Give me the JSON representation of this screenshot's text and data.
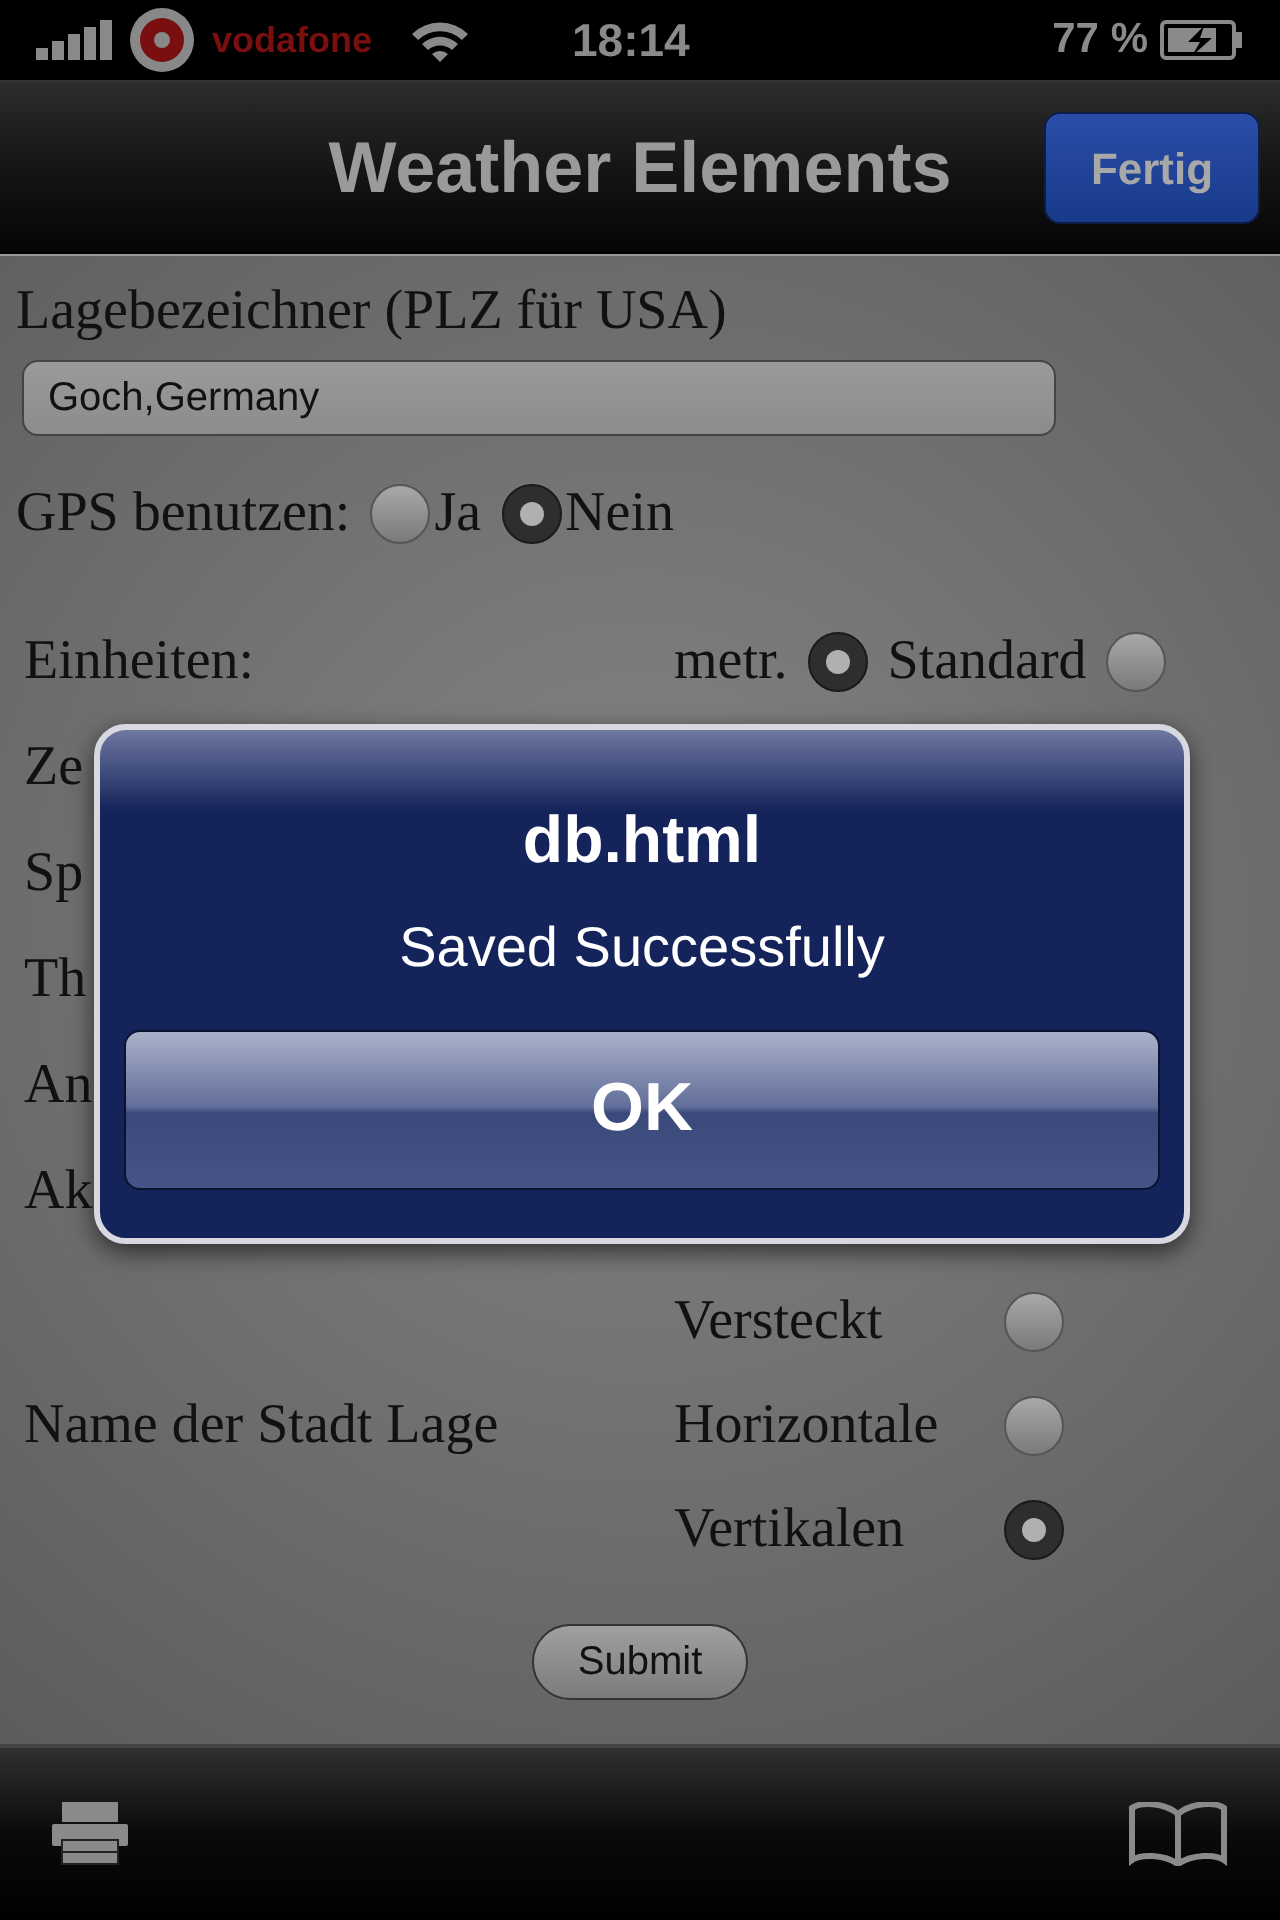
{
  "status_bar": {
    "carrier": "vodafone",
    "time": "18:14",
    "battery": "77 %"
  },
  "nav_bar": {
    "title": "Weather Elements",
    "done_button": "Fertig"
  },
  "form": {
    "location": {
      "label": "Lagebezeichner (PLZ für USA)",
      "value": "Goch,Germany"
    },
    "gps": {
      "label": "GPS benutzen:",
      "options": [
        {
          "label": "Ja",
          "selected": false
        },
        {
          "label": "Nein",
          "selected": true
        }
      ]
    },
    "rows": [
      {
        "kind": "radio",
        "label": "Einheiten:",
        "options": [
          {
            "label": "metr.",
            "selected": true
          },
          {
            "label": "Standard",
            "selected": false
          }
        ]
      },
      {
        "kind": "label",
        "label": "Ze"
      },
      {
        "kind": "label",
        "label": "Sp"
      },
      {
        "kind": "label",
        "label": "Th"
      },
      {
        "kind": "label",
        "label": "An"
      },
      {
        "kind": "label",
        "label": "Ak"
      }
    ],
    "city_name": {
      "label": "Name der Stadt Lage",
      "options": [
        {
          "label": "Versteckt",
          "selected": false
        },
        {
          "label": "Horizontale",
          "selected": false
        },
        {
          "label": "Vertikalen",
          "selected": true
        }
      ]
    },
    "submit": "Submit"
  },
  "alert": {
    "title": "db.html",
    "message": "Saved Successfully",
    "button": "OK"
  }
}
